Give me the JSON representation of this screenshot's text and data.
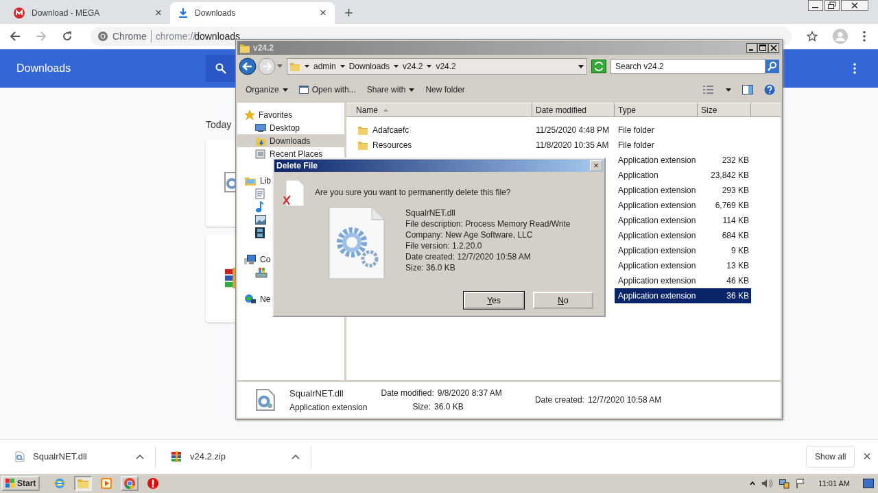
{
  "browser": {
    "tabs": [
      {
        "title": "Download - MEGA",
        "kind": "mega",
        "selected": false
      },
      {
        "title": "Downloads",
        "kind": "download",
        "selected": true
      }
    ],
    "new_tab": "+",
    "close": "×",
    "omnibox": {
      "site": "Chrome",
      "scheme": "chrome://",
      "path": "downloads"
    }
  },
  "downloads_page": {
    "title": "Downloads",
    "section": "Today",
    "cards": [
      {
        "kind": "dll"
      },
      {
        "kind": "archive"
      }
    ]
  },
  "explorer": {
    "title": "v24.2",
    "breadcrumb": [
      "admin",
      "Downloads",
      "v24.2",
      "v24.2"
    ],
    "search_placeholder": "Search v24.2",
    "commands": [
      {
        "label": "Organize",
        "menu": true,
        "icon": false
      },
      {
        "label": "Open with...",
        "menu": false,
        "icon": true
      },
      {
        "label": "Share with",
        "menu": true,
        "icon": false
      },
      {
        "label": "New folder",
        "menu": false,
        "icon": false
      }
    ],
    "nav": [
      {
        "label": "Favorites",
        "kind": "star",
        "children": [
          {
            "label": "Desktop",
            "kind": "desktop",
            "selected": false
          },
          {
            "label": "Downloads",
            "kind": "downloads",
            "selected": true
          },
          {
            "label": "Recent Places",
            "kind": "recent",
            "selected": false
          }
        ]
      },
      {
        "label": "Lib",
        "kind": "library",
        "children": [
          {
            "kind": "documents",
            "selected": false
          },
          {
            "kind": "music",
            "selected": false
          },
          {
            "kind": "pictures",
            "selected": false
          },
          {
            "kind": "videos",
            "selected": false
          }
        ]
      },
      {
        "label": "Co",
        "kind": "computer",
        "children": [
          {
            "kind": "drive",
            "selected": false
          }
        ]
      },
      {
        "label": "Ne",
        "kind": "network"
      }
    ],
    "columns": [
      "Name",
      "Date modified",
      "Type",
      "Size"
    ],
    "rows": [
      {
        "kind": "folder",
        "name": "Adafcaefc",
        "date": "11/25/2020 4:48 PM",
        "type": "File folder",
        "selected": false
      },
      {
        "kind": "folder",
        "name": "Resources",
        "date": "11/8/2020 10:35 AM",
        "type": "File folder",
        "selected": false
      },
      {
        "type": "Application extension",
        "size": "232 KB",
        "selected": false
      },
      {
        "type": "Application",
        "size": "23,842 KB",
        "selected": false
      },
      {
        "type": "Application extension",
        "size": "293 KB",
        "selected": false
      },
      {
        "type": "Application extension",
        "size": "6,769 KB",
        "selected": false
      },
      {
        "type": "Application extension",
        "size": "114 KB",
        "selected": false
      },
      {
        "type": "Application extension",
        "size": "684 KB",
        "selected": false
      },
      {
        "type": "Application extension",
        "size": "9 KB",
        "selected": false
      },
      {
        "type": "Application extension",
        "size": "13 KB",
        "selected": false
      },
      {
        "type": "Application extension",
        "size": "46 KB",
        "selected": false
      },
      {
        "type": "Application extension",
        "size": "36 KB",
        "selected": true
      }
    ],
    "details": {
      "name": "SqualrNET.dll",
      "type": "Application extension",
      "fields": [
        {
          "label": "Date modified:",
          "value": "9/8/2020 8:37 AM"
        },
        {
          "label": "Size:",
          "value": "36.0 KB"
        },
        {
          "label": "Date created:",
          "value": "12/7/2020 10:58 AM"
        }
      ]
    }
  },
  "dialog": {
    "title": "Delete File",
    "close": "×",
    "question": "Are you sure you want to permanently delete this file?",
    "lines": [
      "SqualrNET.dll",
      "File description: Process Memory Read/Write",
      "Company: New Age Software, LLC",
      "File version: 1.2.20.0",
      "Date created: 12/7/2020 10:58 AM",
      "Size: 36.0 KB"
    ],
    "buttons": [
      {
        "label": "Yes",
        "default": true
      },
      {
        "label": "No",
        "default": false
      }
    ]
  },
  "shelf": {
    "items": [
      {
        "name": "SqualrNET.dll",
        "kind": "dll"
      },
      {
        "name": "v24.2.zip",
        "kind": "archive"
      }
    ],
    "show_all": "Show all",
    "close": "×"
  },
  "taskbar": {
    "start": "Start",
    "apps": [
      {
        "kind": "ie",
        "running": false,
        "selected": false
      },
      {
        "kind": "explorer",
        "running": true,
        "selected": true
      },
      {
        "kind": "media",
        "running": false,
        "selected": false
      },
      {
        "kind": "chrome",
        "running": true,
        "selected": false
      },
      {
        "kind": "stop",
        "running": false,
        "selected": false
      }
    ],
    "clock": "11:01 AM"
  }
}
